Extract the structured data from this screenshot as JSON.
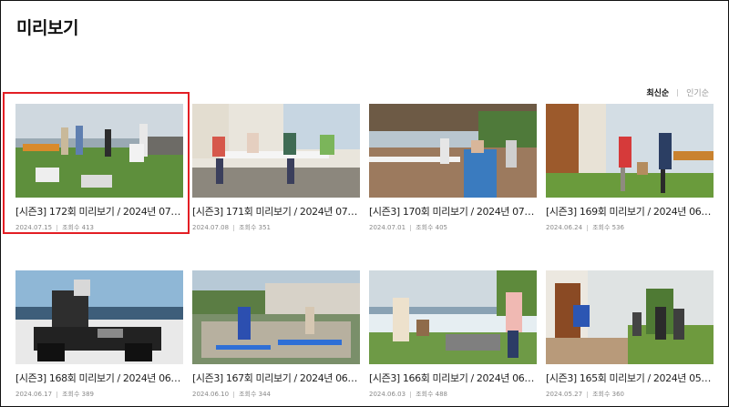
{
  "page": {
    "title": "미리보기"
  },
  "sort": {
    "options": [
      "최신순",
      "인기순"
    ],
    "active": "최신순"
  },
  "cards": [
    {
      "title": "[시즌3] 172회 미리보기 / 2024년 07월…",
      "date": "2024.07.15",
      "views_label": "조회수 413",
      "selected": true
    },
    {
      "title": "[시즌3] 171회 미리보기 / 2024년 07월…",
      "date": "2024.07.08",
      "views_label": "조회수 351"
    },
    {
      "title": "[시즌3] 170회 미리보기 / 2024년 07월…",
      "date": "2024.07.01",
      "views_label": "조회수 405"
    },
    {
      "title": "[시즌3] 169회 미리보기 / 2024년 06월…",
      "date": "2024.06.24",
      "views_label": "조회수 536"
    },
    {
      "title": "[시즌3] 168회 미리보기 / 2024년 06월…",
      "date": "2024.06.17",
      "views_label": "조회수 389"
    },
    {
      "title": "[시즌3] 167회 미리보기 / 2024년 06월…",
      "date": "2024.06.10",
      "views_label": "조회수 344"
    },
    {
      "title": "[시즌3] 166회 미리보기 / 2024년 06월…",
      "date": "2024.06.03",
      "views_label": "조회수 488"
    },
    {
      "title": "[시즌3] 165회 미리보기 / 2024년 05월…",
      "date": "2024.05.27",
      "views_label": "조회수 360"
    }
  ]
}
